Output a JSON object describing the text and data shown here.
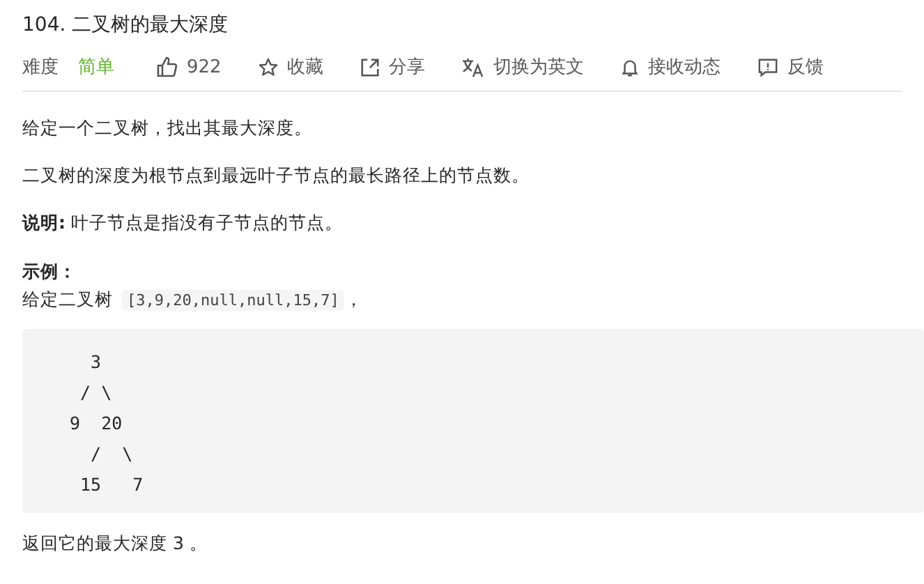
{
  "title": "104. 二叉树的最大深度",
  "toolbar": [
    {
      "kind": "difficulty",
      "label": "难度",
      "value": "简单"
    },
    {
      "kind": "like",
      "label": "922"
    },
    {
      "kind": "star",
      "label": "收藏"
    },
    {
      "kind": "share",
      "label": "分享"
    },
    {
      "kind": "translate",
      "label": "切换为英文"
    },
    {
      "kind": "bell",
      "label": "接收动态"
    },
    {
      "kind": "feedback",
      "label": "反馈"
    }
  ],
  "paragraphs": [
    "给定一个二叉树，找出其最大深度。",
    "二叉树的深度为根节点到最远叶子节点的最长路径上的节点数。",
    "**说明:** 叶子节点是指没有子节点的节点。"
  ],
  "example_heading": "示例：",
  "example_input": {
    "prefix": "给定二叉树",
    "code": "[3,9,20,null,null,15,7]",
    "suffix": "，"
  },
  "code_block": {
    "lines": [
      "  3",
      " / \\",
      "9  20",
      "  /  \\",
      " 15   7"
    ]
  },
  "result": "返回它的最大深度 3 。"
}
